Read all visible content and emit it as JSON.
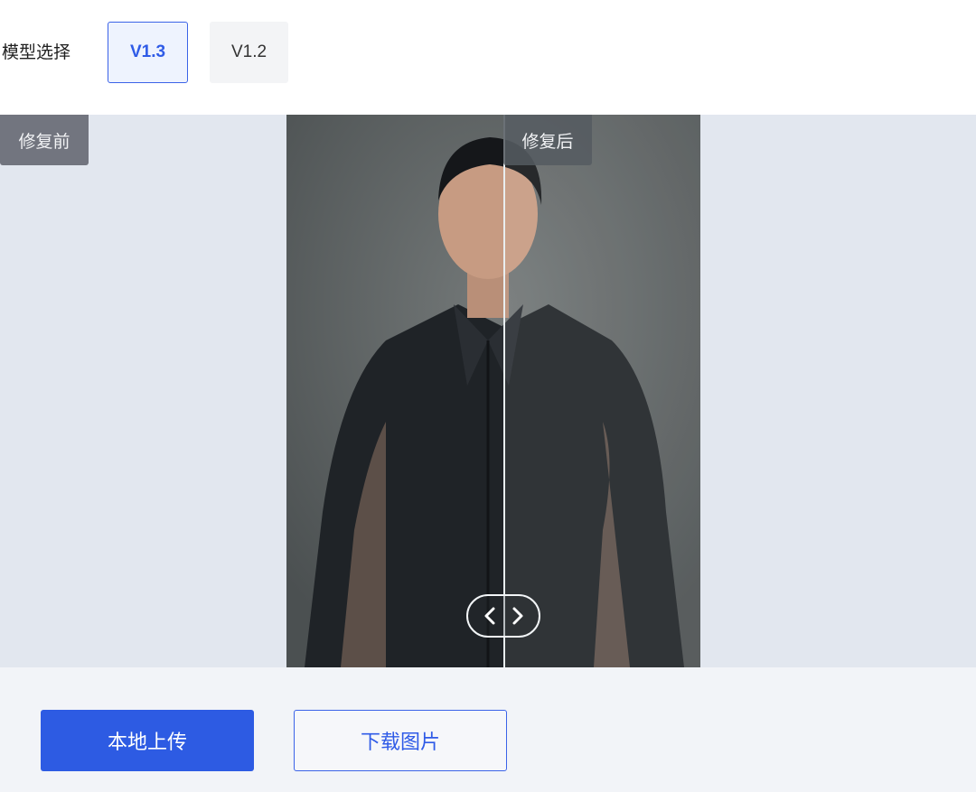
{
  "model": {
    "label": "模型选择",
    "versions": [
      {
        "label": "V1.3",
        "selected": true
      },
      {
        "label": "V1.2",
        "selected": false
      }
    ]
  },
  "compare": {
    "before_label": "修复前",
    "after_label": "修复后",
    "split_fraction": 0.52,
    "handle_icons": [
      "chevron-left-icon",
      "chevron-right-icon"
    ]
  },
  "actions": {
    "upload_label": "本地上传",
    "download_label": "下载图片"
  },
  "colors": {
    "accent": "#2d5be3",
    "stage_bg": "#e2e7ef",
    "footer_bg": "#f2f4f8"
  }
}
